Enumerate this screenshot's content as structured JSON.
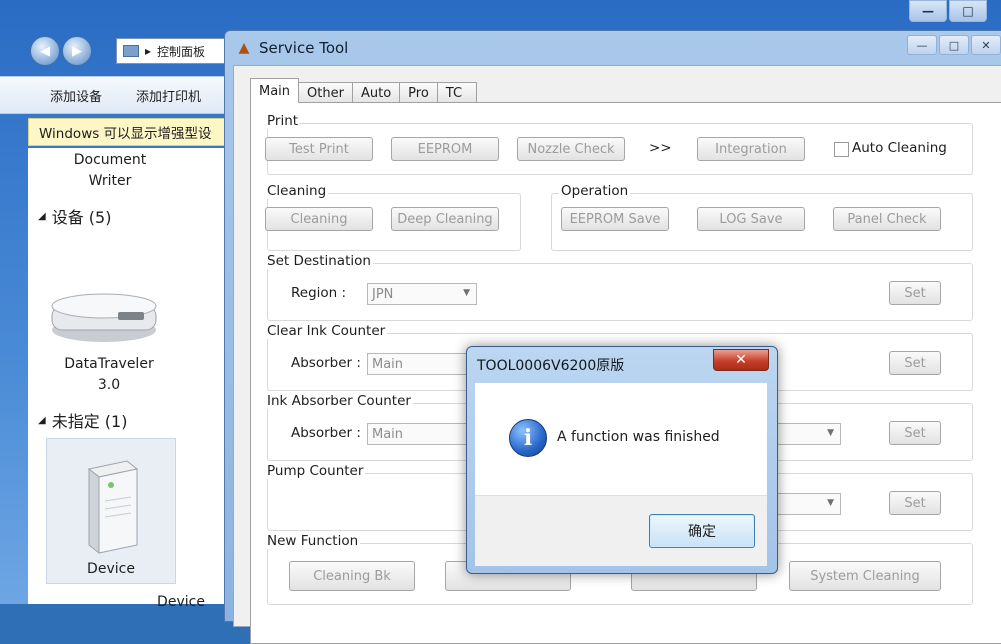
{
  "explorer": {
    "address_text": "控制面板",
    "toolbar": [
      "添加设备",
      "添加打印机"
    ],
    "infobar": "Windows 可以显示增强型设",
    "devices_header": "设备 (5)",
    "unspecified_header": "未指定 (1)",
    "items": {
      "document_writer": [
        "Document",
        "Writer"
      ],
      "datatraveler": [
        "DataTraveler",
        "3.0"
      ],
      "device": "Device",
      "device_bottom": "Device"
    }
  },
  "service_tool": {
    "title": "Service Tool",
    "tabs": [
      "Main",
      "Other",
      "Auto",
      "Pro",
      "TC"
    ],
    "print": {
      "title": "Print",
      "test_print": "Test Print",
      "eeprom": "EEPROM",
      "nozzle_check": "Nozzle Check",
      "arrows": ">>",
      "integration": "Integration",
      "auto_cleaning": "Auto Cleaning"
    },
    "cleaning": {
      "title": "Cleaning",
      "cleaning": "Cleaning",
      "deep_cleaning": "Deep Cleaning"
    },
    "operation": {
      "title": "Operation",
      "eeprom_save": "EEPROM Save",
      "log_save": "LOG Save",
      "panel_check": "Panel Check"
    },
    "set_destination": {
      "title": "Set Destination",
      "region_label": "Region :",
      "region_value": "JPN",
      "set": "Set"
    },
    "clear_ink_counter": {
      "title": "Clear Ink Counter",
      "absorber_label": "Absorber :",
      "absorber_value": "Main",
      "set": "Set"
    },
    "ink_absorber_counter": {
      "title": "Ink Absorber Counter",
      "absorber_label": "Absorber :",
      "absorber_value": "Main",
      "set": "Set"
    },
    "pump_counter": {
      "title": "Pump Counter",
      "set": "Set"
    },
    "new_function": {
      "title": "New Function",
      "cleaning_bk": "Cleaning Bk",
      "system_cleaning": "System Cleaning"
    }
  },
  "dialog": {
    "title": "TOOL0006V6200原版",
    "message": "A function was finished",
    "ok": "确定",
    "close": "✕"
  }
}
